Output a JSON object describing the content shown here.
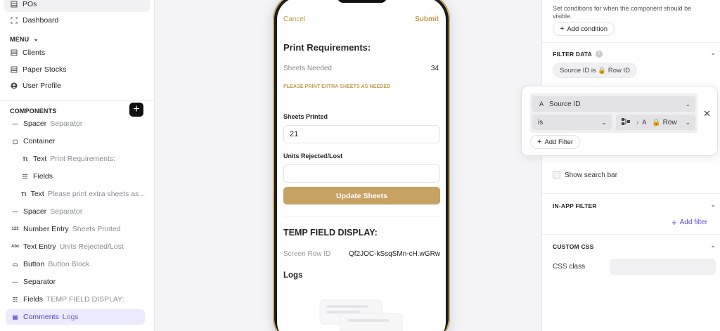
{
  "left": {
    "top_items": [
      {
        "label": "POs",
        "icon": "table-icon"
      },
      {
        "label": "Dashboard",
        "icon": "dashboard-icon"
      }
    ],
    "menu_label": "MENU",
    "menu_items": [
      {
        "label": "Clients",
        "icon": "table-icon"
      },
      {
        "label": "Paper Stocks",
        "icon": "table-icon"
      },
      {
        "label": "User Profile",
        "icon": "user-icon"
      }
    ],
    "components_label": "COMPONENTS",
    "add_symbol": "+",
    "components": [
      {
        "icon": "—",
        "label": "Spacer",
        "sub": "Separator"
      },
      {
        "icon": "▢",
        "label": "Container",
        "sub": ""
      },
      {
        "icon": "Tt",
        "label": "Text",
        "sub": "Print Requirements:"
      },
      {
        "icon": "☷",
        "label": "Fields",
        "sub": ""
      },
      {
        "icon": "Tt",
        "label": "Text",
        "sub": "Please print extra sheets as ..."
      },
      {
        "icon": "—",
        "label": "Spacer",
        "sub": "Separator"
      },
      {
        "icon": "123",
        "label": "Number Entry",
        "sub": "Sheets Printed"
      },
      {
        "icon": "Abc",
        "label": "Text Entry",
        "sub": "Units Rejected/Lost"
      },
      {
        "icon": "▭",
        "label": "Button",
        "sub": "Button Block"
      },
      {
        "icon": "—",
        "label": "Separator",
        "sub": ""
      },
      {
        "icon": "☷",
        "label": "Fields",
        "sub": "TEMP FIELD DISPLAY:"
      },
      {
        "icon": "▤",
        "label": "Comments",
        "sub": "Logs"
      }
    ]
  },
  "phone": {
    "cancel": "Cancel",
    "submit": "Submit",
    "print_title": "Print Requirements:",
    "sheets_needed_label": "Sheets Needed",
    "sheets_needed_value": "34",
    "note": "PLEASE PRINT EXTRA SHEETS AS NEEDED",
    "sheets_printed_label": "Sheets Printed",
    "sheets_printed_value": "21",
    "units_rejected_label": "Units Rejected/Lost",
    "units_rejected_value": "",
    "update_button": "Update Sheets",
    "temp_title": "TEMP FIELD DISPLAY:",
    "row_id_label": "Screen Row ID",
    "row_id_value": "Qf2JOC-kSsqSMn-cH.wGRw",
    "logs_title": "Logs"
  },
  "right": {
    "visibility_hint": "Set conditions for when the component should be visible.",
    "add_condition": "Add condition",
    "filter_data_label": "FILTER DATA",
    "filter_pill": "Source ID is 🔒 Row ID",
    "show_search_bar": "Show search bar",
    "in_app_filter_label": "IN-APP FILTER",
    "add_filter_link": "Add filter",
    "custom_css_label": "CUSTOM CSS",
    "css_class_label": "CSS class",
    "css_class_value": ""
  },
  "popover": {
    "field_type": "A",
    "field": "Source ID",
    "operator": "is",
    "value_type": "A",
    "value": "🔒 Row",
    "add_filter": "Add Filter"
  },
  "colors": {
    "accent_gold": "#c8a262",
    "selection_purple": "#4b3fd6",
    "add_filter_purple": "#5b45e0"
  }
}
